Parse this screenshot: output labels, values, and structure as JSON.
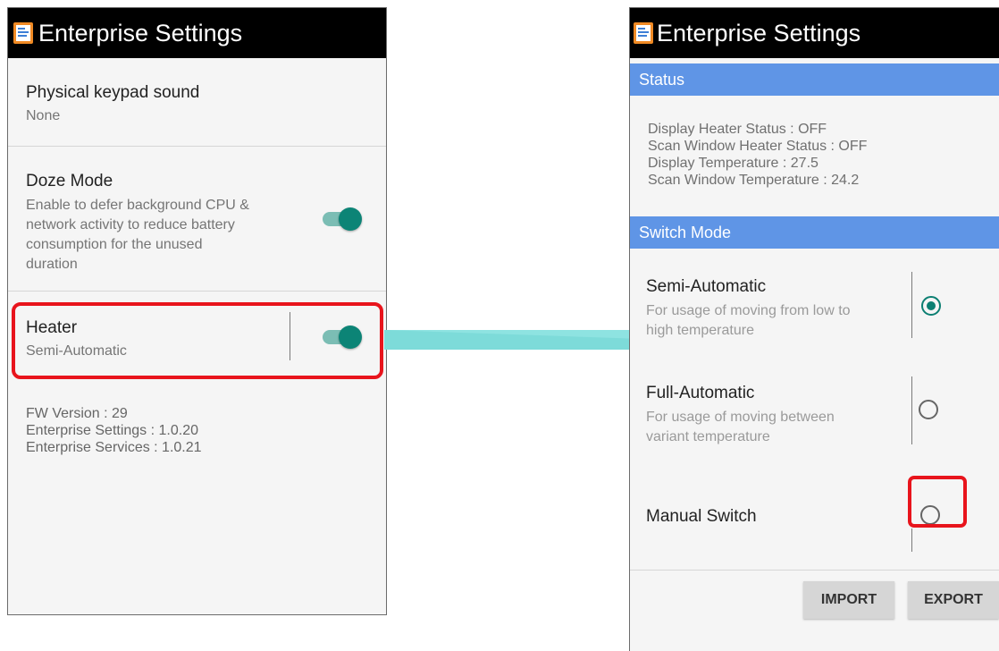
{
  "left": {
    "title": "Enterprise Settings",
    "items": [
      {
        "title": "Physical keypad sound",
        "summary": "None"
      },
      {
        "title": "Doze Mode",
        "summary_lines": [
          "Enable to defer background CPU &",
          "network activity to reduce battery",
          "consumption for the unused",
          "duration"
        ],
        "toggle_on": true
      },
      {
        "title": "Heater",
        "summary": "Semi-Automatic",
        "toggle_on": true
      }
    ],
    "version_lines": [
      "FW Version : 29",
      "Enterprise Settings : 1.0.20",
      "Enterprise Services : 1.0.21"
    ]
  },
  "right": {
    "title": "Enterprise Settings",
    "status_header": "Status",
    "status_lines": [
      "Display Heater Status : OFF",
      "Scan Window Heater Status : OFF",
      "Display Temperature : 27.5",
      "Scan Window Temperature : 24.2"
    ],
    "switch_header": "Switch Mode",
    "options": [
      {
        "title": "Semi-Automatic",
        "summary_lines": [
          "For usage of moving from low to",
          "high temperature"
        ],
        "selected": true
      },
      {
        "title": "Full-Automatic",
        "summary_lines": [
          "For usage of moving between",
          "variant temperature"
        ],
        "selected": false
      },
      {
        "title": "Manual Switch",
        "selected": false
      }
    ],
    "buttons": {
      "import": "IMPORT",
      "export": "EXPORT"
    }
  },
  "colors": {
    "highlight": "#e8141c",
    "section_header": "#5f95e6",
    "toggle_accent": "#0c8476",
    "arrow": "#7ddbd9"
  },
  "icons": [
    "app-settings-icon",
    "toggle-switch",
    "radio-button"
  ]
}
